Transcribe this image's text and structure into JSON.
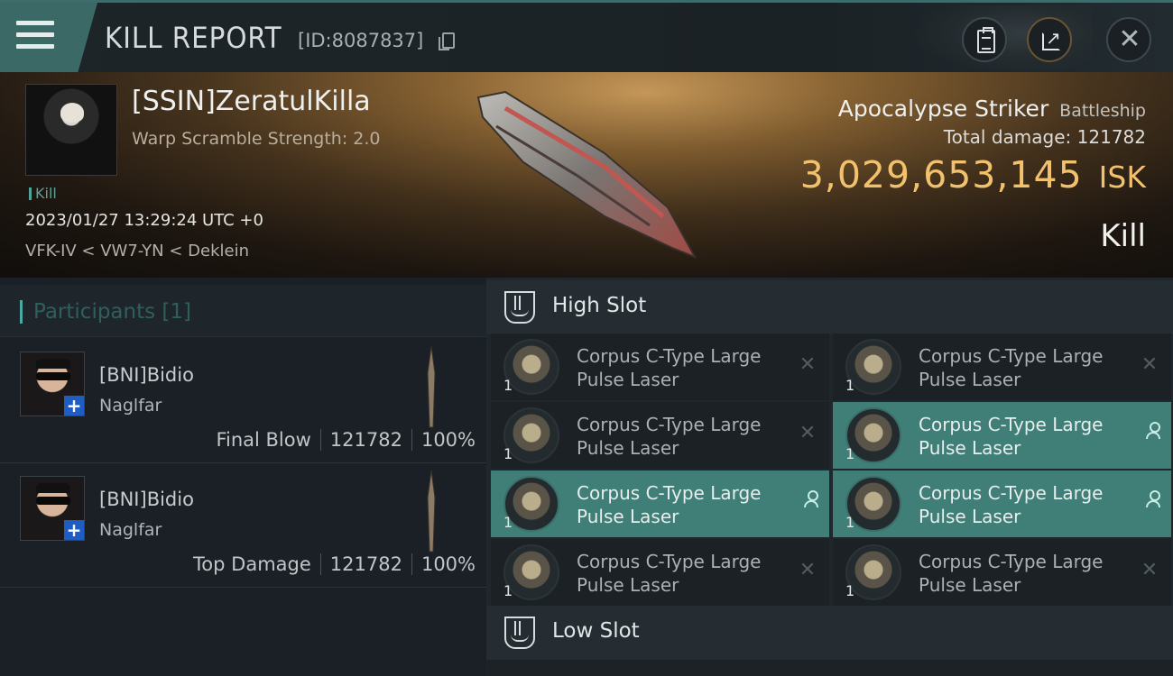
{
  "header": {
    "title": "KILL REPORT",
    "report_id": "[ID:8087837]"
  },
  "victim": {
    "name": "[SSIN]ZeratulKilla",
    "warp_scramble": "Warp Scramble Strength: 2.0",
    "tag": "Kill",
    "datetime": "2023/01/27 13:29:24 UTC +0",
    "location": "VFK-IV < VW7-YN < Deklein",
    "ship_name": "Apocalypse Striker",
    "ship_class": "Battleship",
    "total_damage_label": "Total damage:",
    "total_damage": "121782",
    "isk_value": "3,029,653,145",
    "isk_unit": "ISK",
    "result": "Kill"
  },
  "participants": {
    "title": "Participants [1]",
    "rows": [
      {
        "name": "[BNI]Bidio",
        "ship": "Naglfar",
        "role": "Final Blow",
        "damage": "121782",
        "percent": "100%"
      },
      {
        "name": "[BNI]Bidio",
        "ship": "Naglfar",
        "role": "Top Damage",
        "damage": "121782",
        "percent": "100%"
      }
    ]
  },
  "slots": {
    "high_title": "High Slot",
    "low_title": "Low Slot",
    "high_modules": [
      {
        "line1": "Corpus C-Type Large",
        "line2": "Pulse Laser",
        "qty": "1",
        "status": "destroyed"
      },
      {
        "line1": "Corpus C-Type Large",
        "line2": "Pulse Laser",
        "qty": "1",
        "status": "destroyed"
      },
      {
        "line1": "Corpus C-Type Large",
        "line2": "Pulse Laser",
        "qty": "1",
        "status": "destroyed"
      },
      {
        "line1": "Corpus C-Type Large",
        "line2": "Pulse Laser",
        "qty": "1",
        "status": "dropped"
      },
      {
        "line1": "Corpus C-Type Large",
        "line2": "Pulse Laser",
        "qty": "1",
        "status": "dropped"
      },
      {
        "line1": "Corpus C-Type Large",
        "line2": "Pulse Laser",
        "qty": "1",
        "status": "dropped"
      },
      {
        "line1": "Corpus C-Type Large",
        "line2": "Pulse Laser",
        "qty": "1",
        "status": "destroyed"
      },
      {
        "line1": "Corpus C-Type Large",
        "line2": "Pulse Laser",
        "qty": "1",
        "status": "destroyed"
      }
    ]
  },
  "colors": {
    "accent_teal": "#3f7f77",
    "isk_gold": "#f2c16d",
    "panel_dark": "#1a2025"
  },
  "icons": {
    "menu": "hamburger-icon",
    "copy": "copy-icon",
    "clipboard": "clipboard-icon",
    "share": "share-icon",
    "close": "close-icon",
    "slot": "high-slot-icon",
    "destroyed": "destroyed-x-icon",
    "dropped": "dropped-person-icon"
  }
}
